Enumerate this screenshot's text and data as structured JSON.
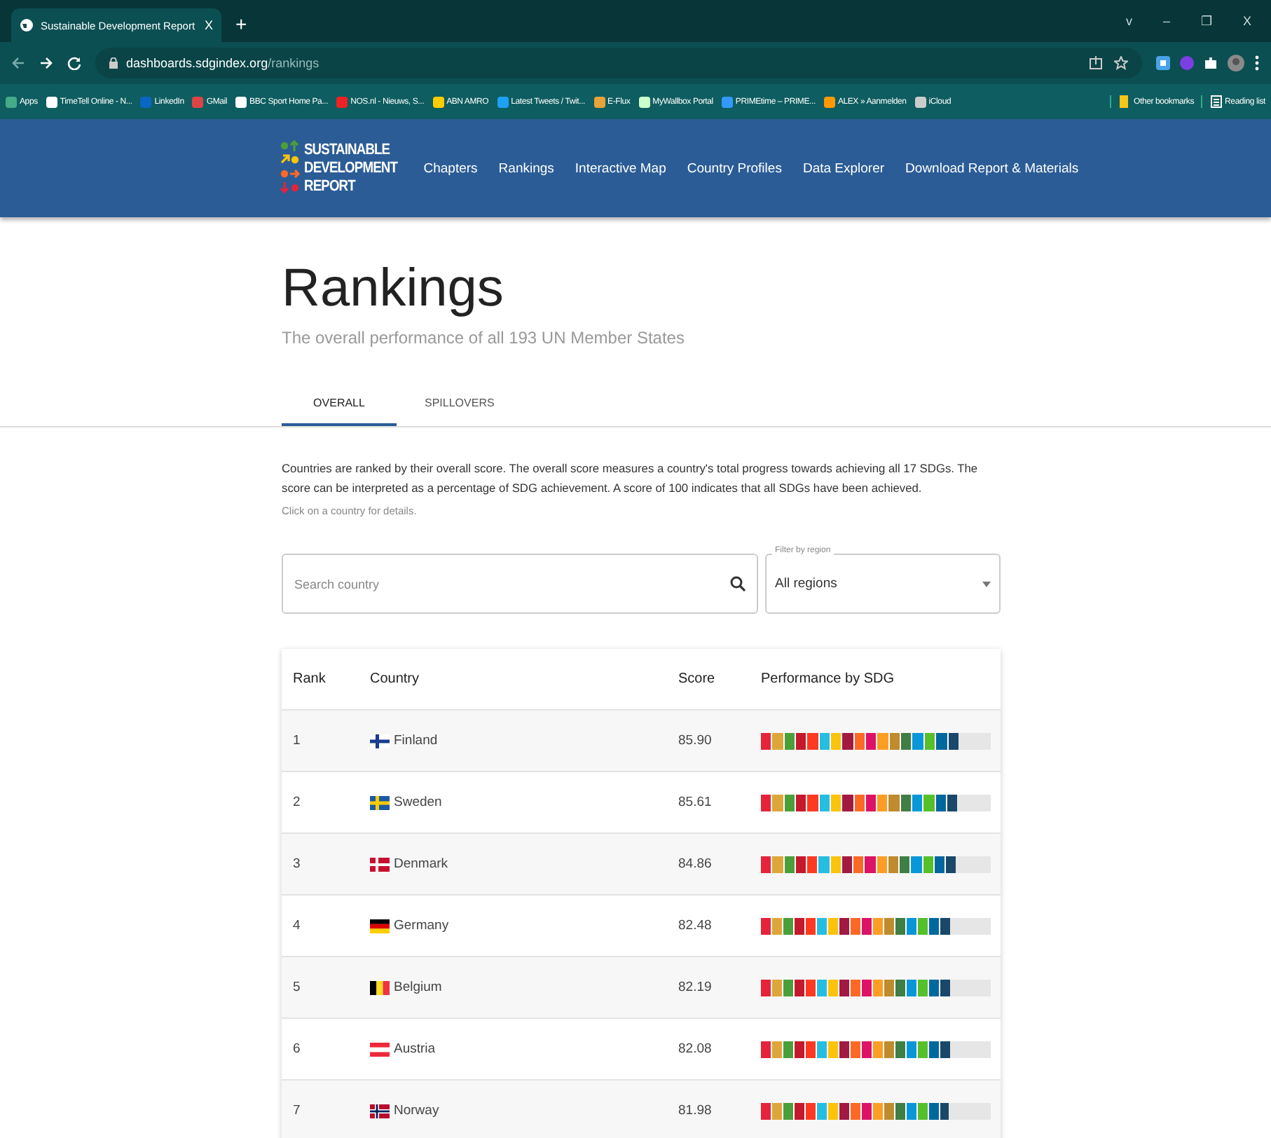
{
  "browser": {
    "tab": {
      "title": "Sustainable Development Report",
      "close": "X"
    },
    "new_tab": "+",
    "window_controls": [
      "v",
      "–",
      "❐",
      "X"
    ],
    "address": {
      "host": "dashboards.sdgindex.org",
      "path": "/rankings"
    },
    "bookmarks": [
      {
        "label": "Apps"
      },
      {
        "label": "TimeTell Online - N..."
      },
      {
        "label": "LinkedIn"
      },
      {
        "label": "GMail"
      },
      {
        "label": "BBC Sport Home Pa..."
      },
      {
        "label": "NOS.nl - Nieuws, S..."
      },
      {
        "label": "ABN AMRO"
      },
      {
        "label": "Latest Tweets / Twit..."
      },
      {
        "label": "E-Flux"
      },
      {
        "label": "MyWallbox Portal"
      },
      {
        "label": "PRIMEtime – PRIME..."
      },
      {
        "label": "ALEX » Aanmelden"
      },
      {
        "label": "iCloud"
      }
    ],
    "bookmarks_right": [
      "Other bookmarks",
      "Reading list"
    ]
  },
  "site": {
    "logo_lines": [
      "SUSTAINABLE",
      "DEVELOPMENT",
      "REPORT"
    ],
    "nav": [
      "Chapters",
      "Rankings",
      "Interactive Map",
      "Country Profiles",
      "Data Explorer",
      "Download Report & Materials"
    ]
  },
  "page": {
    "title": "Rankings",
    "subtitle": "The overall performance of all 193 UN Member States",
    "tabs": [
      {
        "label": "OVERALL",
        "selected": true
      },
      {
        "label": "SPILLOVERS",
        "selected": false
      }
    ],
    "description": "Countries are ranked by their overall score. The overall score measures a country's total progress towards achieving all 17 SDGs. The score can be interpreted as a percentage of SDG achievement. A score of 100 indicates that all SDGs have been achieved.",
    "hint": "Click on a country for details.",
    "search": {
      "placeholder": "Search country"
    },
    "region_filter": {
      "label": "Filter by region",
      "value": "All regions"
    }
  },
  "table": {
    "columns": [
      "Rank",
      "Country",
      "Score",
      "Performance by SDG"
    ],
    "rows": [
      {
        "rank": "1",
        "country": "Finland",
        "score": "85.90",
        "level": 0.859
      },
      {
        "rank": "2",
        "country": "Sweden",
        "score": "85.61",
        "level": 0.856
      },
      {
        "rank": "3",
        "country": "Denmark",
        "score": "84.86",
        "level": 0.849
      },
      {
        "rank": "4",
        "country": "Germany",
        "score": "82.48",
        "level": 0.825
      },
      {
        "rank": "5",
        "country": "Belgium",
        "score": "82.19",
        "level": 0.822
      },
      {
        "rank": "6",
        "country": "Austria",
        "score": "82.08",
        "level": 0.821
      },
      {
        "rank": "7",
        "country": "Norway",
        "score": "81.98",
        "level": 0.82
      }
    ]
  }
}
